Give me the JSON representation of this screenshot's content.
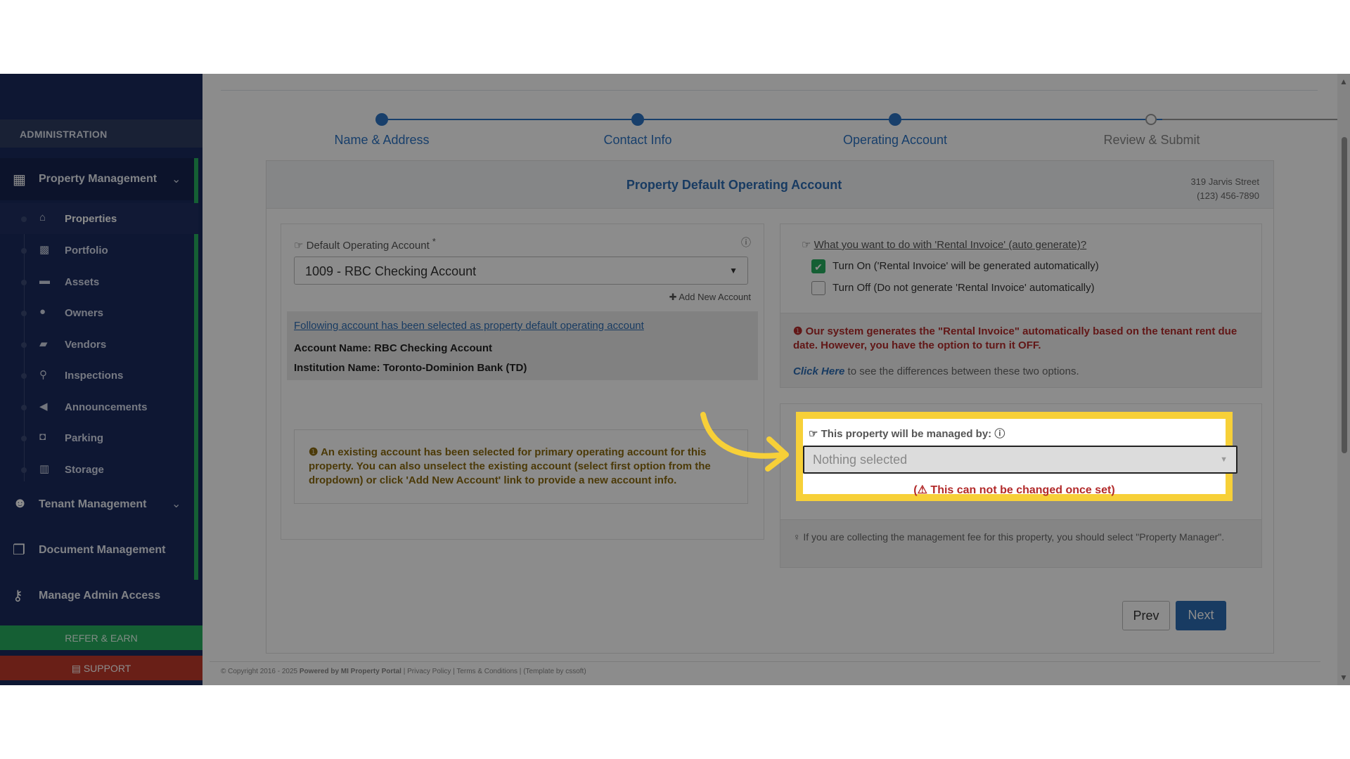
{
  "sidebar": {
    "admin_label": "ADMINISTRATION",
    "property_management": "Property Management",
    "items": [
      {
        "label": "Properties",
        "icon": "home-icon"
      },
      {
        "label": "Portfolio",
        "icon": "portfolio-icon"
      },
      {
        "label": "Assets",
        "icon": "assets-icon"
      },
      {
        "label": "Owners",
        "icon": "owner-icon"
      },
      {
        "label": "Vendors",
        "icon": "briefcase-icon"
      },
      {
        "label": "Inspections",
        "icon": "magnifier-icon"
      },
      {
        "label": "Announcements",
        "icon": "megaphone-icon"
      },
      {
        "label": "Parking",
        "icon": "car-icon"
      },
      {
        "label": "Storage",
        "icon": "storage-icon"
      }
    ],
    "tenant_management": "Tenant Management",
    "document_management": "Document Management",
    "manage_admin_access": "Manage Admin Access",
    "refer_earn": "REFER & EARN",
    "support": "SUPPORT"
  },
  "stepper": {
    "steps": [
      "Name & Address",
      "Contact Info",
      "Operating Account",
      "Review & Submit"
    ]
  },
  "card": {
    "title": "Property Default Operating Account",
    "address_line1": "319 Jarvis Street",
    "address_line2": "(123) 456-7890"
  },
  "left_panel": {
    "label": "Default Operating Account",
    "required_mark": "*",
    "selected_value": "1009 - RBC Checking Account",
    "add_new": "Add New Account",
    "selected_notice": "Following account has been selected as property default operating account",
    "account_name": "Account Name: RBC Checking Account",
    "institution_name": "Institution Name: Toronto-Dominion Bank (TD)",
    "note": "An existing account has been selected for primary operating account for this property. You can also unselect the existing account (select first option from the dropdown) or click 'Add New Account' link to provide a new account info."
  },
  "right_panel": {
    "question": "What you want to do with 'Rental Invoice' (auto generate)?",
    "option_on": "Turn On ('Rental Invoice' will be generated automatically)",
    "option_off": "Turn Off (Do not generate 'Rental Invoice' automatically)",
    "warning": "Our system generates the \"Rental Invoice\" automatically based on the tenant rent due date. However, you have the option to turn it OFF.",
    "click_here": "Click Here",
    "click_here_rest": "to see the differences between these two options."
  },
  "managed_by": {
    "label": "This property will be managed by:",
    "placeholder": "Nothing selected",
    "warning": "This can not be changed once set",
    "tip": "If you are collecting the management fee for this property, you should select \"Property Manager\"."
  },
  "buttons": {
    "prev": "Prev",
    "next": "Next"
  },
  "footer": {
    "copyright": "© Copyright 2016 - 2025",
    "powered": "Powered by MI Property Portal",
    "privacy": "Privacy Policy",
    "terms": "Terms & Conditions",
    "template": "(Template by cssoft)"
  },
  "colors": {
    "sidebar_bg": "#1a2a5e",
    "accent_blue": "#2d6cb3",
    "accent_green": "#27ae60",
    "support_red": "#c0392b",
    "highlight_yellow": "#f7d038",
    "warning_red": "#b22a2a"
  }
}
